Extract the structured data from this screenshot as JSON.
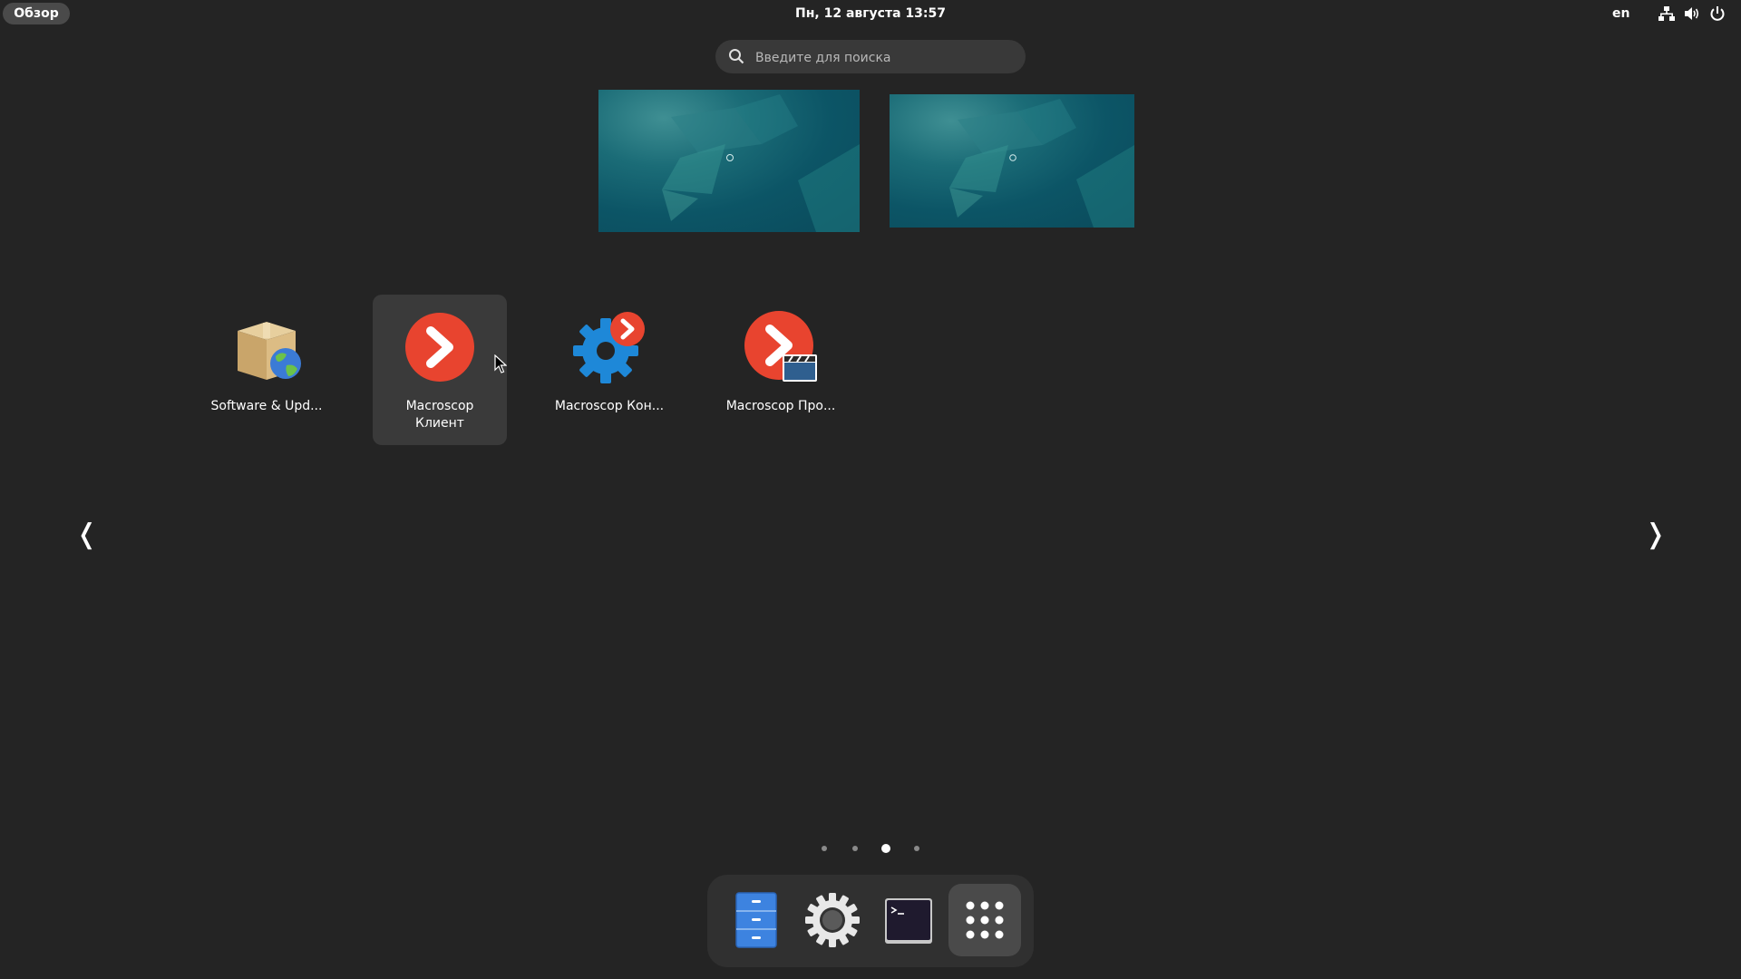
{
  "topbar": {
    "activities_label": "Обзор",
    "clock": "Пн, 12 августа  13:57",
    "language": "en",
    "tray_icons": [
      "network-icon",
      "volume-icon",
      "power-icon"
    ]
  },
  "search": {
    "placeholder": "Введите для поиска",
    "value": ""
  },
  "workspaces": [
    {
      "name": "workspace-1"
    },
    {
      "name": "workspace-2"
    }
  ],
  "apps": [
    {
      "label": "Software & Upd...",
      "icon": "software-updates-icon"
    },
    {
      "label": "Macroscop\nКлиент",
      "icon": "macroscop-client-icon",
      "hovered": true
    },
    {
      "label": "Macroscop Кон...",
      "icon": "macroscop-config-icon"
    },
    {
      "label": "Macroscop Про...",
      "icon": "macroscop-player-icon"
    }
  ],
  "pager": {
    "pages": 4,
    "current_page": 3,
    "prev_glyph": "❬",
    "next_glyph": "❭"
  },
  "dash": {
    "items": [
      {
        "name": "files-icon"
      },
      {
        "name": "settings-icon"
      },
      {
        "name": "terminal-icon"
      },
      {
        "name": "show-apps-icon",
        "selected": true
      }
    ]
  },
  "colors": {
    "background": "#242424",
    "macroscop_red": "#e8442f",
    "gear_blue": "#1e88d8",
    "wallpaper_teal": "#0c5566"
  }
}
